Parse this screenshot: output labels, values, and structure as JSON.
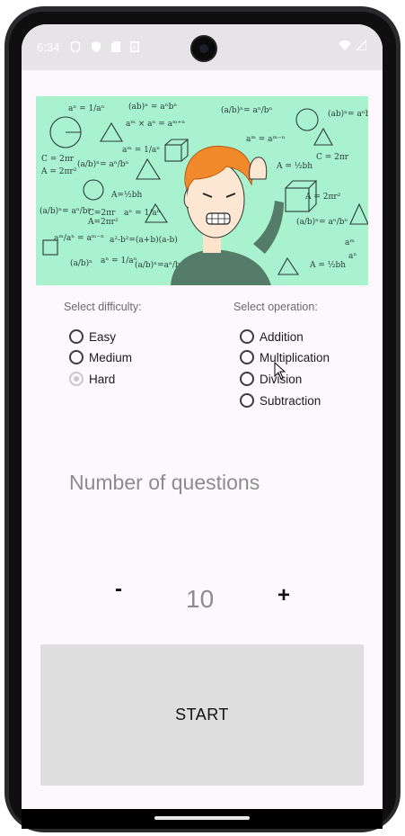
{
  "status_bar": {
    "time": "6:34"
  },
  "difficulty": {
    "label": "Select difficulty:",
    "options": [
      "Easy",
      "Medium",
      "Hard"
    ],
    "selected": "Hard"
  },
  "operation": {
    "label": "Select operation:",
    "options": [
      "Addition",
      "Multiplication",
      "Division",
      "Subtraction"
    ],
    "selected": ""
  },
  "questions": {
    "label": "Number of questions",
    "minus": "-",
    "plus": "+",
    "count": "10"
  },
  "start_button": "START",
  "banner": {
    "formulas": [
      "(ab)ⁿ = aⁿbⁿ",
      "aᵐ × aⁿ = aᵐ⁺ⁿ",
      "C = 2πr",
      "A = 2πr²",
      "A = ½bh",
      "A = 2πr²",
      "aᵐ/aⁿ = aᵐ⁻ⁿ",
      "(a/b)ⁿ = aⁿ/bⁿ",
      "aⁿ = 1/aⁿ",
      "a² - b² = (a+b)(a-b)"
    ]
  },
  "colors": {
    "banner_bg": "#a8f2cf",
    "screen_bg": "#fdf8fc",
    "button_bg": "#dedede"
  }
}
